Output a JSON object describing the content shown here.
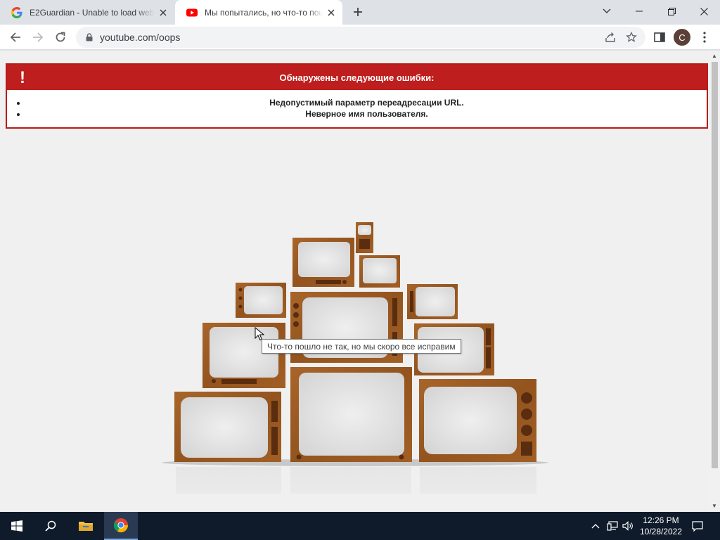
{
  "browser": {
    "tabs": [
      {
        "title": "E2Guardian - Unable to load web page",
        "favicon": "google-g-icon"
      },
      {
        "title": "Мы попытались, но что-то пошло не так",
        "favicon": "youtube-icon",
        "active": true
      }
    ],
    "new_tab_icon": "plus-icon",
    "window_controls": [
      "chevron-down-icon",
      "minimize-icon",
      "restore-icon",
      "close-icon"
    ],
    "url": "youtube.com/oops",
    "profile_initial": "C"
  },
  "page": {
    "error_heading": "Обнаружены следующие ошибки:",
    "error_icon": "!",
    "errors": [
      "Недопустимый параметр переадресации URL.",
      "Неверное имя пользователя."
    ],
    "tooltip": "Что-то пошло не так, но мы скоро все исправим"
  },
  "taskbar": {
    "time": "12:26 PM",
    "date": "10/28/2022"
  },
  "colors": {
    "error_red": "#bf1e1e",
    "page_bg": "#f0f0f0",
    "tv_wood": "#9c5a22",
    "taskbar": "#0f1b2b"
  }
}
